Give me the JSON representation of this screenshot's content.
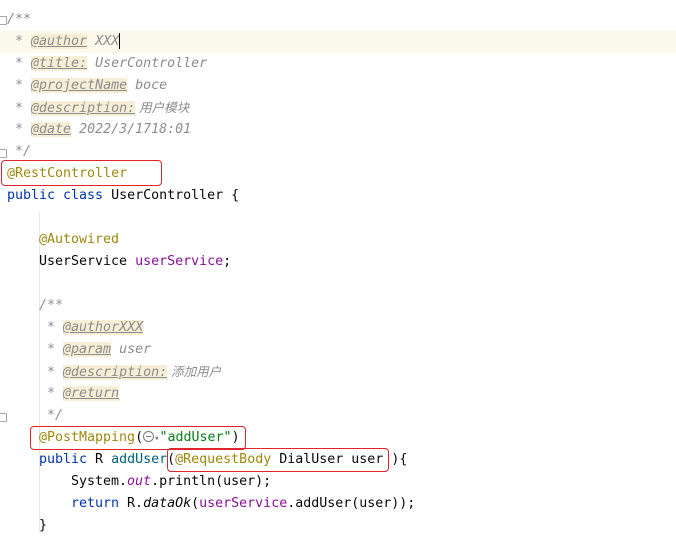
{
  "editor": {
    "file_class": "UserController",
    "lines": {
      "l1": "/**",
      "l2_prefix": " * ",
      "l2_tag": "@author",
      "l2_val": " XXX",
      "l3_tag": "@title:",
      "l3_val": " UserController",
      "l4_tag": "@projectName",
      "l4_val": " boce",
      "l5_tag": "@description:",
      "l5_val": " 用户模块",
      "l6_tag": "@date",
      "l6_val": " 2022/3/1718:01",
      "l7": " */",
      "l8": "@RestController",
      "l9_kw": "public class",
      "l9_rest": " UserController {",
      "l11": "@Autowired",
      "l12_type": "UserService ",
      "l12_field": "userService",
      "l12_end": ";",
      "l14": "/**",
      "l15_tag": "@authorXXX",
      "l16_tag": "@param",
      "l16_val": " user",
      "l17_tag": "@description:",
      "l17_val": " 添加用户",
      "l18_tag": "@return",
      "l19": " */",
      "l20_annot": "@PostMapping",
      "l20_open": "(",
      "l20_str": "\"addUser\"",
      "l20_close": ")",
      "l21_kw": "public",
      "l21_type": " R ",
      "l21_method": "addUser",
      "l21_paren": "(",
      "l21_annot": "@RequestBody",
      "l21_param": " DialUser user ",
      "l21_end": "){",
      "l22_a": "System.",
      "l22_out": "out",
      "l22_b": ".println(user);",
      "l23_kw": "return",
      "l23_a": " R.",
      "l23_m": "dataOk",
      "l23_b": "(",
      "l23_f": "userService",
      "l23_c": ".addUser(user));",
      "l24": "}"
    }
  },
  "colors": {
    "highlight_box": "#e0242b",
    "annotation": "#9e880d",
    "keyword": "#0033b3",
    "string": "#067d17",
    "field": "#871094",
    "comment": "#8c8c8c"
  }
}
